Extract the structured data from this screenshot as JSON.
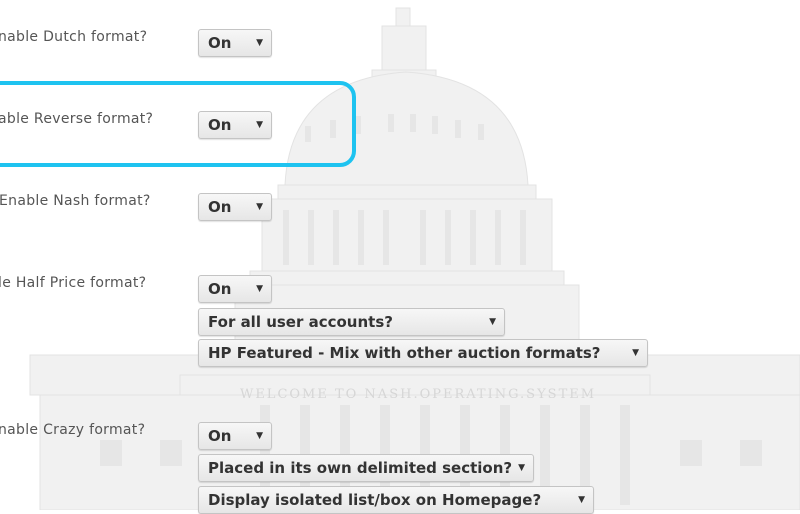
{
  "background": {
    "banner_text": "WELCOME TO NASH.OPERATING.SYSTEM"
  },
  "settings": {
    "dutch": {
      "label": "nable Dutch format?",
      "value": "On"
    },
    "reverse": {
      "label": "able Reverse format?",
      "value": "On"
    },
    "nash": {
      "label": "Enable Nash format?",
      "value": "On"
    },
    "half_price": {
      "label": "le Half Price format?",
      "value": "On",
      "scope": "For all user accounts?",
      "featured": "HP Featured - Mix with other auction formats?"
    },
    "crazy": {
      "label": "nable Crazy format?",
      "value": "On",
      "placement": "Placed in its own delimited section?",
      "display": "Display isolated list/box on Homepage?"
    }
  },
  "colors": {
    "highlight": "#1ec3f0",
    "label": "#555555"
  },
  "icons": {
    "dropdown": "caret-down-icon"
  }
}
